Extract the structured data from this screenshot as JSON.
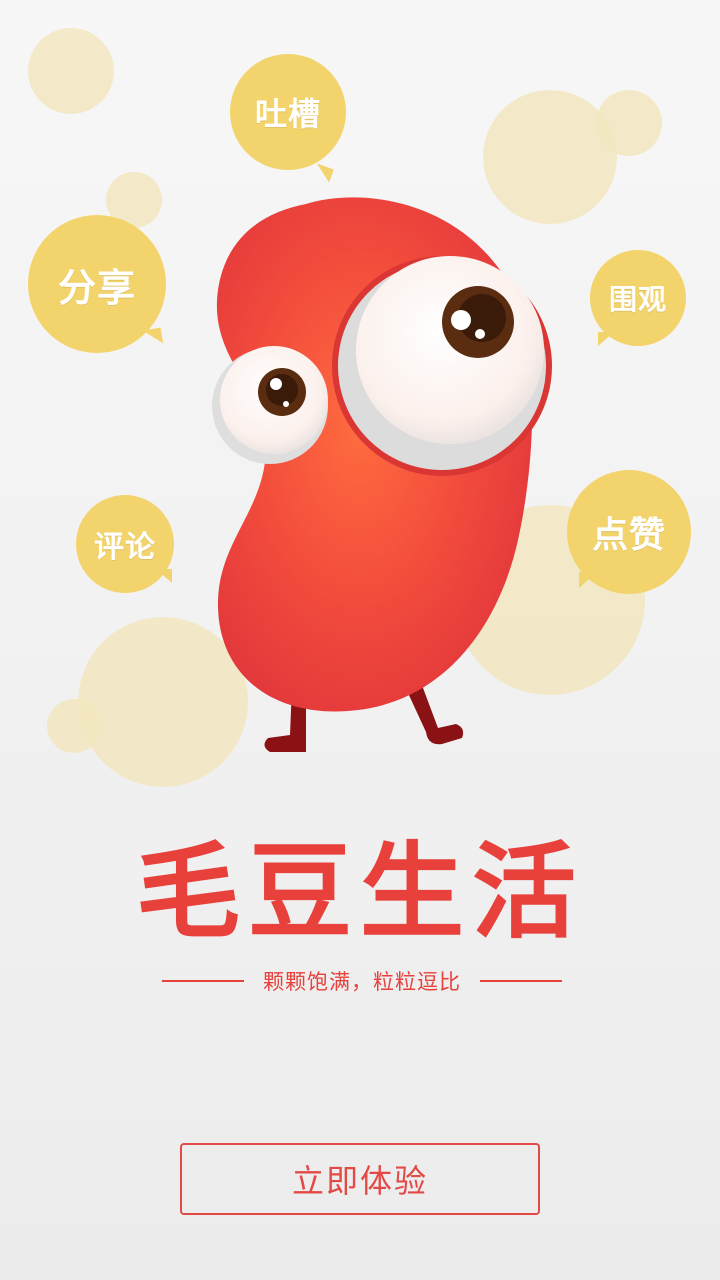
{
  "bubbles": {
    "tucao": "吐槽",
    "fenxiang": "分享",
    "weiguan": "围观",
    "pinglun": "评论",
    "dianzan": "点赞"
  },
  "brand": {
    "title": "毛豆生活",
    "tagline": "颗颗饱满，粒粒逗比"
  },
  "cta": {
    "label": "立即体验"
  },
  "colors": {
    "accent": "#e8403b",
    "bubble": "#f3d36b",
    "decor": "#f2e6be"
  },
  "icons": {
    "mascot": "bean-mascot-icon"
  }
}
